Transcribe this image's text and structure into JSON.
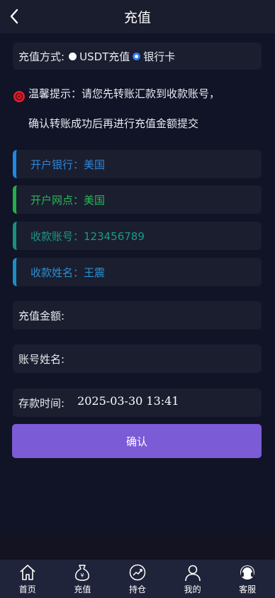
{
  "header": {
    "title": "充值"
  },
  "method": {
    "label": "充值方式:",
    "options": [
      "USDT充值",
      "银行卡"
    ],
    "selected": "银行卡"
  },
  "tip": {
    "line1": "温馨提示：请您先转账汇款到收款账号，",
    "line2": "确认转账成功后再进行充值金额提交"
  },
  "bank": {
    "bank_name": "开户银行：美国",
    "branch": "开户网点：美国",
    "account_no": "收款账号：123456789",
    "account_name": "收款姓名：王震"
  },
  "form": {
    "amount_label": "充值金额:",
    "amount_value": "",
    "name_label": "账号姓名:",
    "name_value": "",
    "time_label": "存款时间:",
    "time_value": "2025-03-30 13:41"
  },
  "confirm_label": "确认",
  "nav": [
    {
      "label": "首页",
      "icon": "home-icon"
    },
    {
      "label": "充值",
      "icon": "money-bag-icon"
    },
    {
      "label": "持仓",
      "icon": "chart-icon"
    },
    {
      "label": "我的",
      "icon": "user-icon"
    },
    {
      "label": "客服",
      "icon": "headset-icon"
    }
  ]
}
